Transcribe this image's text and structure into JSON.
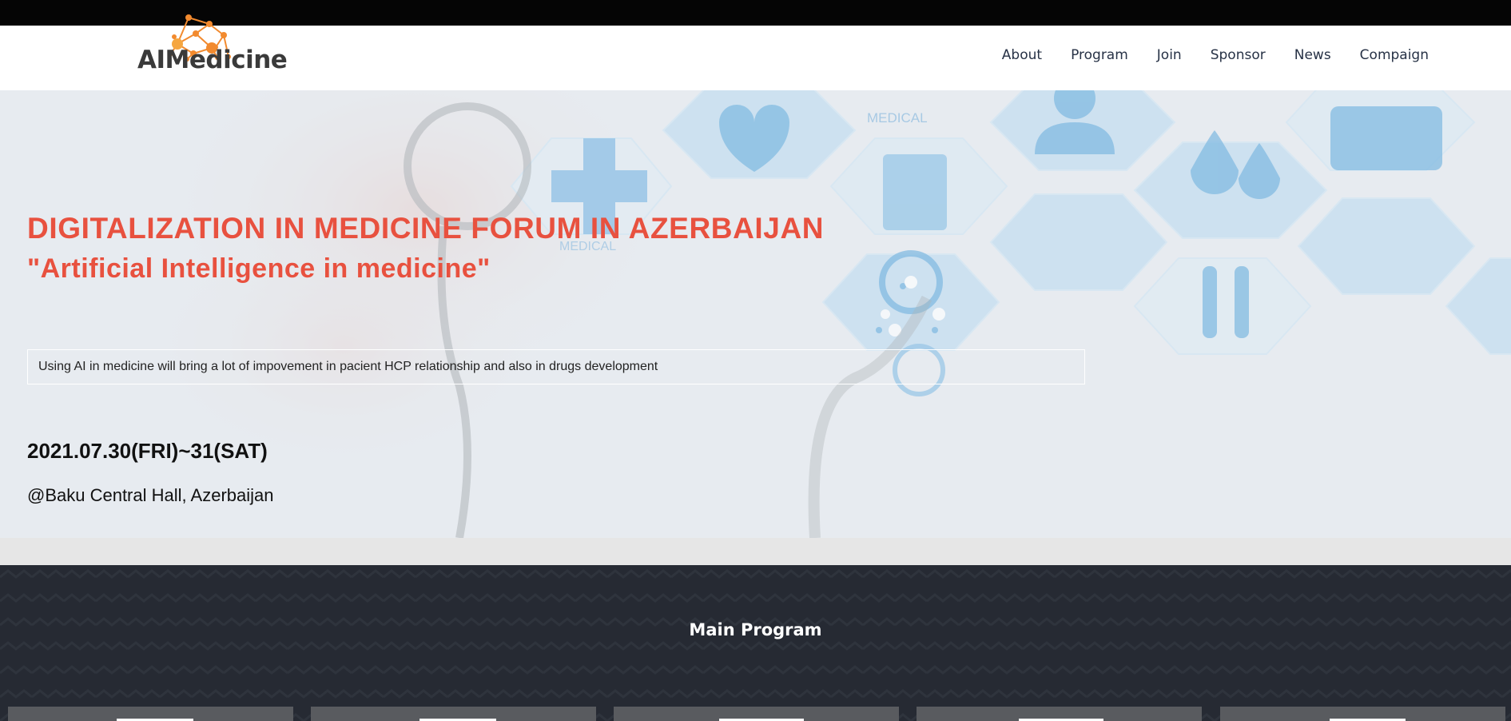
{
  "brand": {
    "logo_text": "AIMedicine",
    "logo_color": "#f28a2e",
    "logo_alt_color": "#f5a640"
  },
  "nav": {
    "items": [
      "About",
      "Program",
      "Join",
      "Sponsor",
      "News",
      "Compaign"
    ]
  },
  "hero": {
    "title": "DIGITALIZATION IN MEDICINE FORUM IN AZERBAIJAN",
    "subtitle": "\"Artificial Intelligence in medicine\"",
    "description": "Using AI in medicine will bring a lot of impovement in pacient HCP relationship and also in drugs development",
    "date": "2021.07.30(FRI)~31(SAT)",
    "venue": "@Baku Central Hall, Azerbaijan",
    "accent_color": "#e8513f",
    "background_labels": [
      "MEDICAL",
      "MEDICAL"
    ]
  },
  "program": {
    "title": "Main Program",
    "card_count_visible": 5
  }
}
